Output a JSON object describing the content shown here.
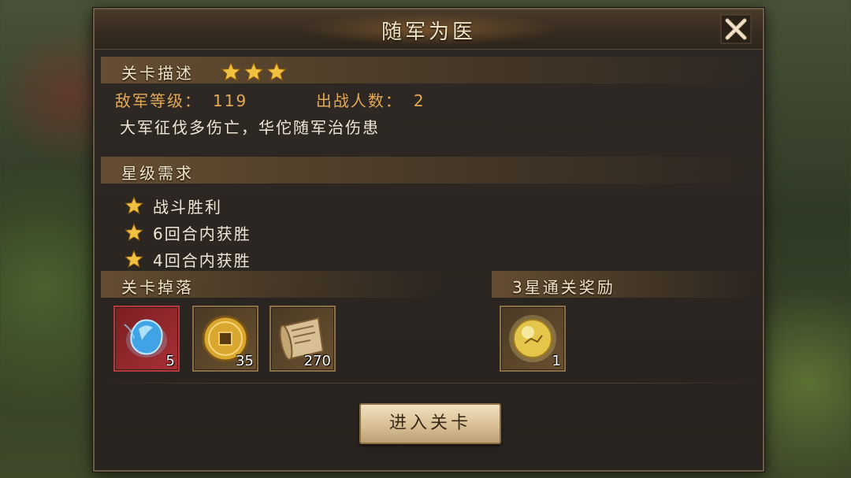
{
  "dialog": {
    "title": "随军为医",
    "close_icon": "close-icon"
  },
  "stage_desc": {
    "header": "关卡描述",
    "stars": 3,
    "enemy_level_label": "敌军等级：",
    "enemy_level": "119",
    "troop_count_label": "出战人数：",
    "troop_count": "2",
    "description": "大军征伐多伤亡，华佗随军治伤患"
  },
  "star_requirements": {
    "header": "星级需求",
    "items": [
      "战斗胜利",
      "6回合内获胜",
      "4回合内获胜"
    ]
  },
  "drops": {
    "header": "关卡掉落",
    "items": [
      {
        "icon": "blue-gem-icon",
        "count": "5"
      },
      {
        "icon": "gold-coin-icon",
        "count": "35"
      },
      {
        "icon": "scroll-icon",
        "count": "270"
      }
    ]
  },
  "reward": {
    "header": "3星通关奖励",
    "items": [
      {
        "icon": "golden-orb-icon",
        "count": "1"
      }
    ]
  },
  "enter_button": "进入关卡",
  "colors": {
    "label_gold": "#e3a957",
    "text_light": "#efe6d6",
    "star": "#f0c040",
    "rare_border": "#b8393b"
  }
}
